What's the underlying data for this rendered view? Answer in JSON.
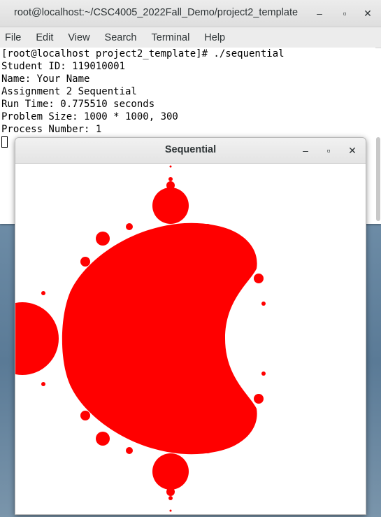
{
  "terminal": {
    "title": "root@localhost:~/CSC4005_2022Fall_Demo/project2_template",
    "minimize_icon": "minimize-icon",
    "maximize_icon": "maximize-icon",
    "close_icon": "close-icon",
    "menu": [
      "File",
      "Edit",
      "View",
      "Search",
      "Terminal",
      "Help"
    ],
    "lines": [
      "[root@localhost project2_template]# ./sequential",
      "Student ID: 119010001",
      "Name: Your Name",
      "Assignment 2 Sequential",
      "Run Time: 0.775510 seconds",
      "Problem Size: 1000 * 1000, 300",
      "Process Number: 1"
    ]
  },
  "sequential_window": {
    "title": "Sequential",
    "minimize_glyph": "–",
    "maximize_glyph": "▪",
    "close_glyph": "✕",
    "fill_color": "#ff0000",
    "background_color": "#ffffff"
  },
  "glyphs": {
    "minimize": "–",
    "maximize": "▫",
    "close": "✕"
  }
}
